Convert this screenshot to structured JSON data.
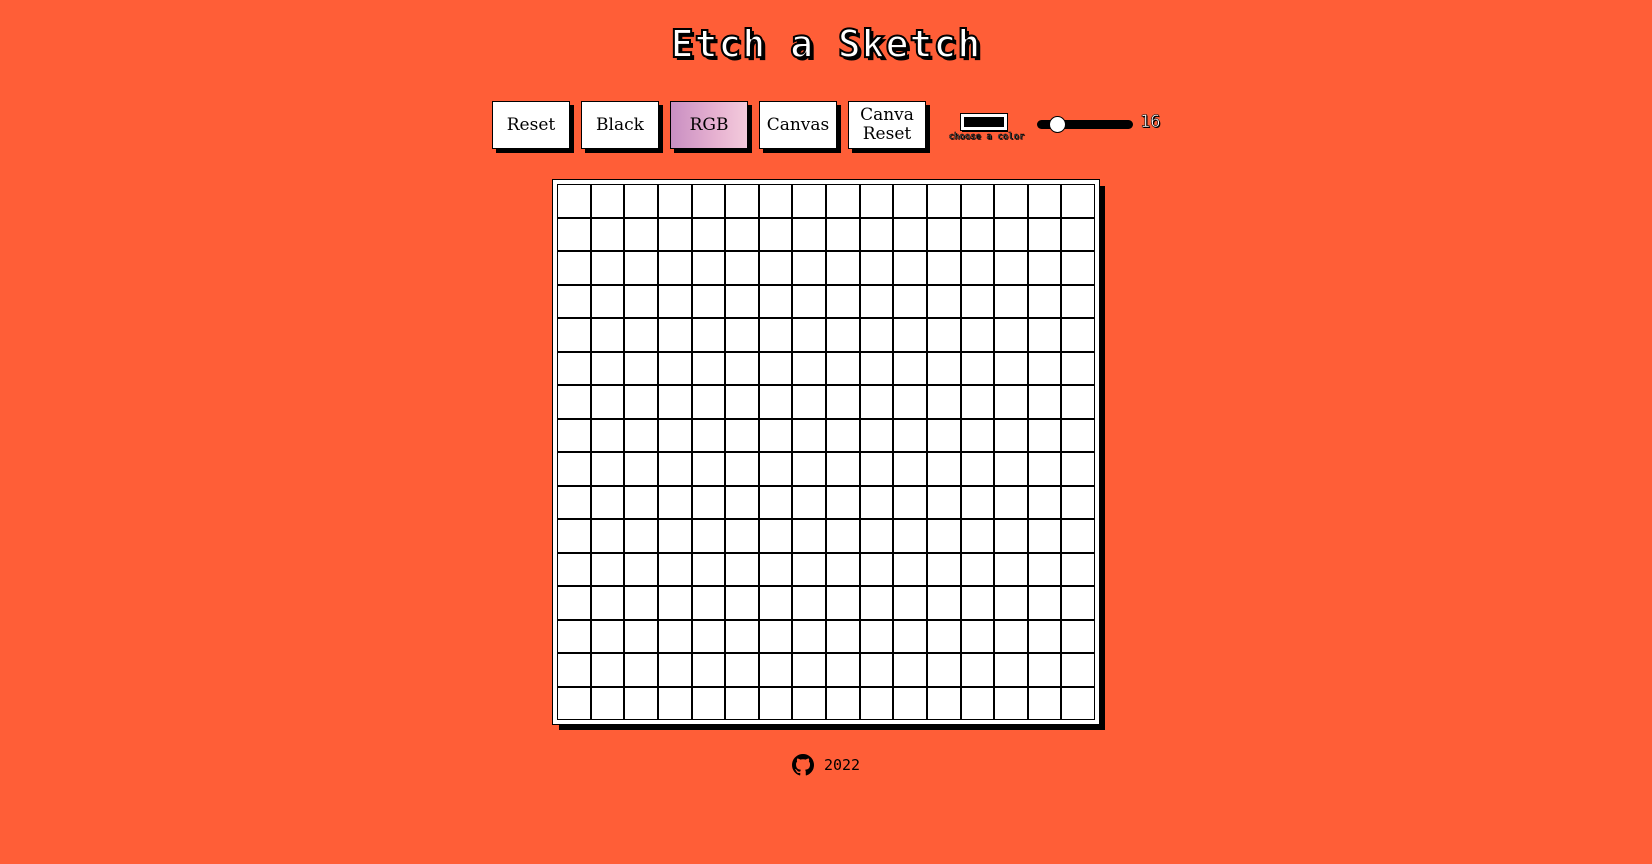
{
  "header": {
    "title": "Etch a Sketch"
  },
  "toolbar": {
    "reset_label": "Reset",
    "black_label": "Black",
    "rgb_label": "RGB",
    "canvas_label": "Canvas",
    "canva_reset_label": "Canva Reset",
    "color_picker": {
      "value": "#000000",
      "label": "choose a color"
    },
    "size_slider": {
      "value": 16,
      "min": 1,
      "max": 100,
      "value_label": "16"
    }
  },
  "canvas": {
    "rows": 16,
    "columns": 16,
    "cell_color": "#ffffff",
    "line_color": "#000000"
  },
  "footer": {
    "icon": "github-icon",
    "year": "2022"
  },
  "colors": {
    "background": "#ff5e37",
    "accent": "#000000",
    "rgb_gradient_start": "#c98fc2",
    "rgb_gradient_end": "#f3cbdc"
  }
}
